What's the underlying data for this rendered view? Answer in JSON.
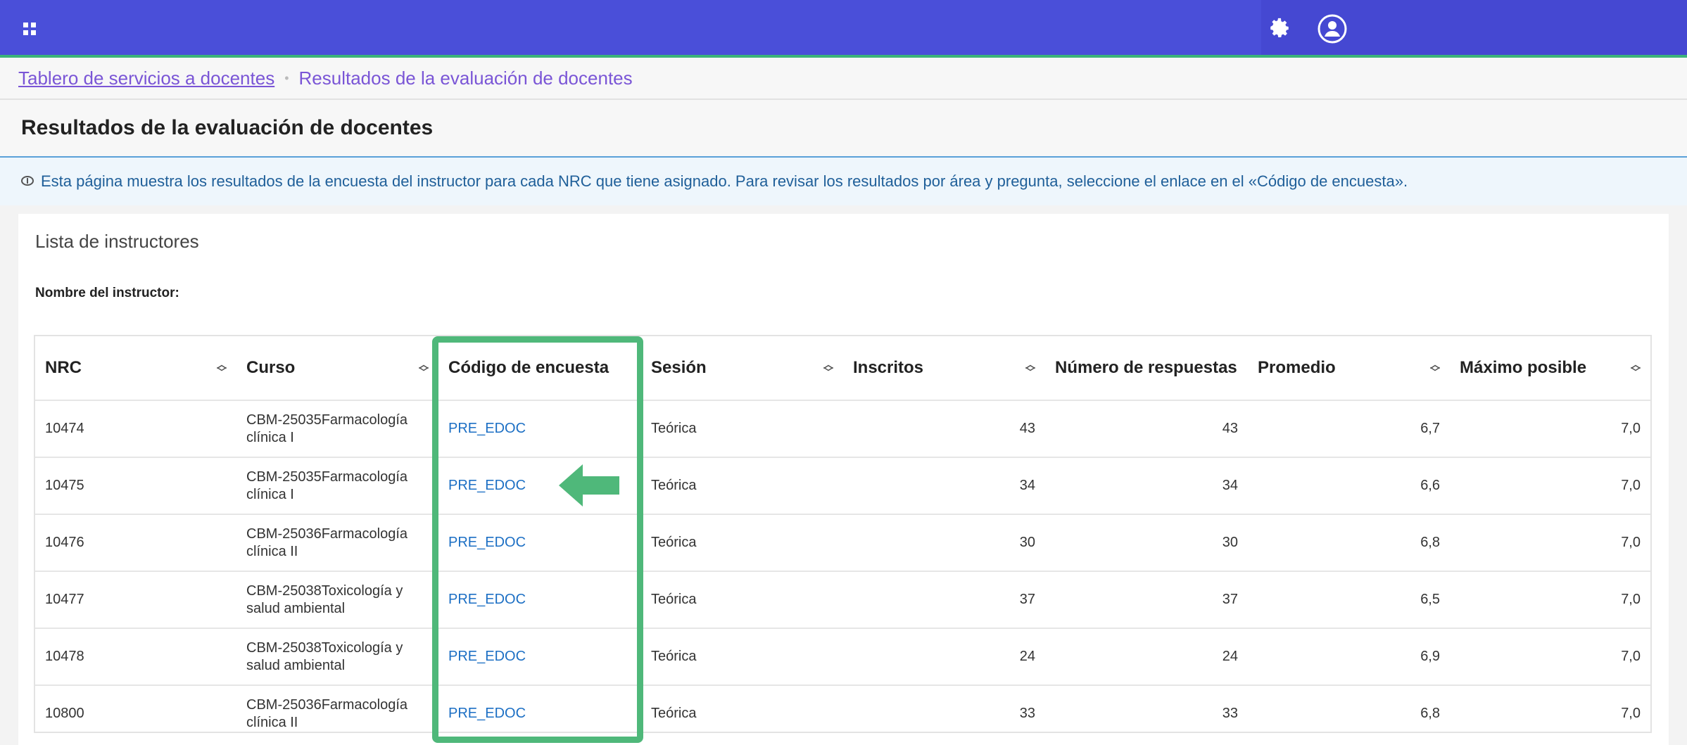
{
  "header": {
    "apps_icon": "apps-grid-icon",
    "settings_icon": "gear-icon",
    "user_icon": "user-icon",
    "colors": {
      "bar": "#4a4fd9",
      "accent": "#3cb37a"
    }
  },
  "breadcrumb": {
    "home_label": "Tablero de servicios a docentes",
    "separator": "•",
    "current_label": "Resultados de la evaluación de docentes"
  },
  "page": {
    "title": "Resultados de la evaluación de docentes",
    "info_icon": "info-icon",
    "info_text": "Esta página muestra los resultados de la encuesta del instructor para cada NRC que tiene asignado. Para revisar los resultados por área y pregunta, seleccione el enlace en el «Código de encuesta».",
    "card_heading": "Lista de instructores",
    "instructor_label": "Nombre del instructor:"
  },
  "table": {
    "columns": [
      {
        "label": "NRC",
        "sortable": true
      },
      {
        "label": "Curso",
        "sortable": true
      },
      {
        "label": "Código de encuesta",
        "sortable": false
      },
      {
        "label": "Sesión",
        "sortable": true
      },
      {
        "label": "Inscritos",
        "sortable": true
      },
      {
        "label": "Número de respuestas",
        "sortable": false
      },
      {
        "label": "Promedio",
        "sortable": true
      },
      {
        "label": "Máximo posible",
        "sortable": true
      }
    ],
    "rows": [
      {
        "nrc": "10474",
        "curso": "CBM-25035Farmacología clínica I",
        "codigo": "PRE_EDOC",
        "sesion": "Teórica",
        "inscritos": "43",
        "respuestas": "43",
        "promedio": "6,7",
        "maximo": "7,0"
      },
      {
        "nrc": "10475",
        "curso": "CBM-25035Farmacología clínica I",
        "codigo": "PRE_EDOC",
        "sesion": "Teórica",
        "inscritos": "34",
        "respuestas": "34",
        "promedio": "6,6",
        "maximo": "7,0"
      },
      {
        "nrc": "10476",
        "curso": "CBM-25036Farmacología clínica II",
        "codigo": "PRE_EDOC",
        "sesion": "Teórica",
        "inscritos": "30",
        "respuestas": "30",
        "promedio": "6,8",
        "maximo": "7,0"
      },
      {
        "nrc": "10477",
        "curso": "CBM-25038Toxicología y salud ambiental",
        "codigo": "PRE_EDOC",
        "sesion": "Teórica",
        "inscritos": "37",
        "respuestas": "37",
        "promedio": "6,5",
        "maximo": "7,0"
      },
      {
        "nrc": "10478",
        "curso": "CBM-25038Toxicología y salud ambiental",
        "codigo": "PRE_EDOC",
        "sesion": "Teórica",
        "inscritos": "24",
        "respuestas": "24",
        "promedio": "6,9",
        "maximo": "7,0"
      },
      {
        "nrc": "10800",
        "curso": "CBM-25036Farmacología clínica II",
        "codigo": "PRE_EDOC",
        "sesion": "Teórica",
        "inscritos": "33",
        "respuestas": "33",
        "promedio": "6,8",
        "maximo": "7,0"
      }
    ]
  },
  "annotation": {
    "highlight_color": "#4fb87a",
    "arrow_icon": "left-arrow-icon"
  }
}
